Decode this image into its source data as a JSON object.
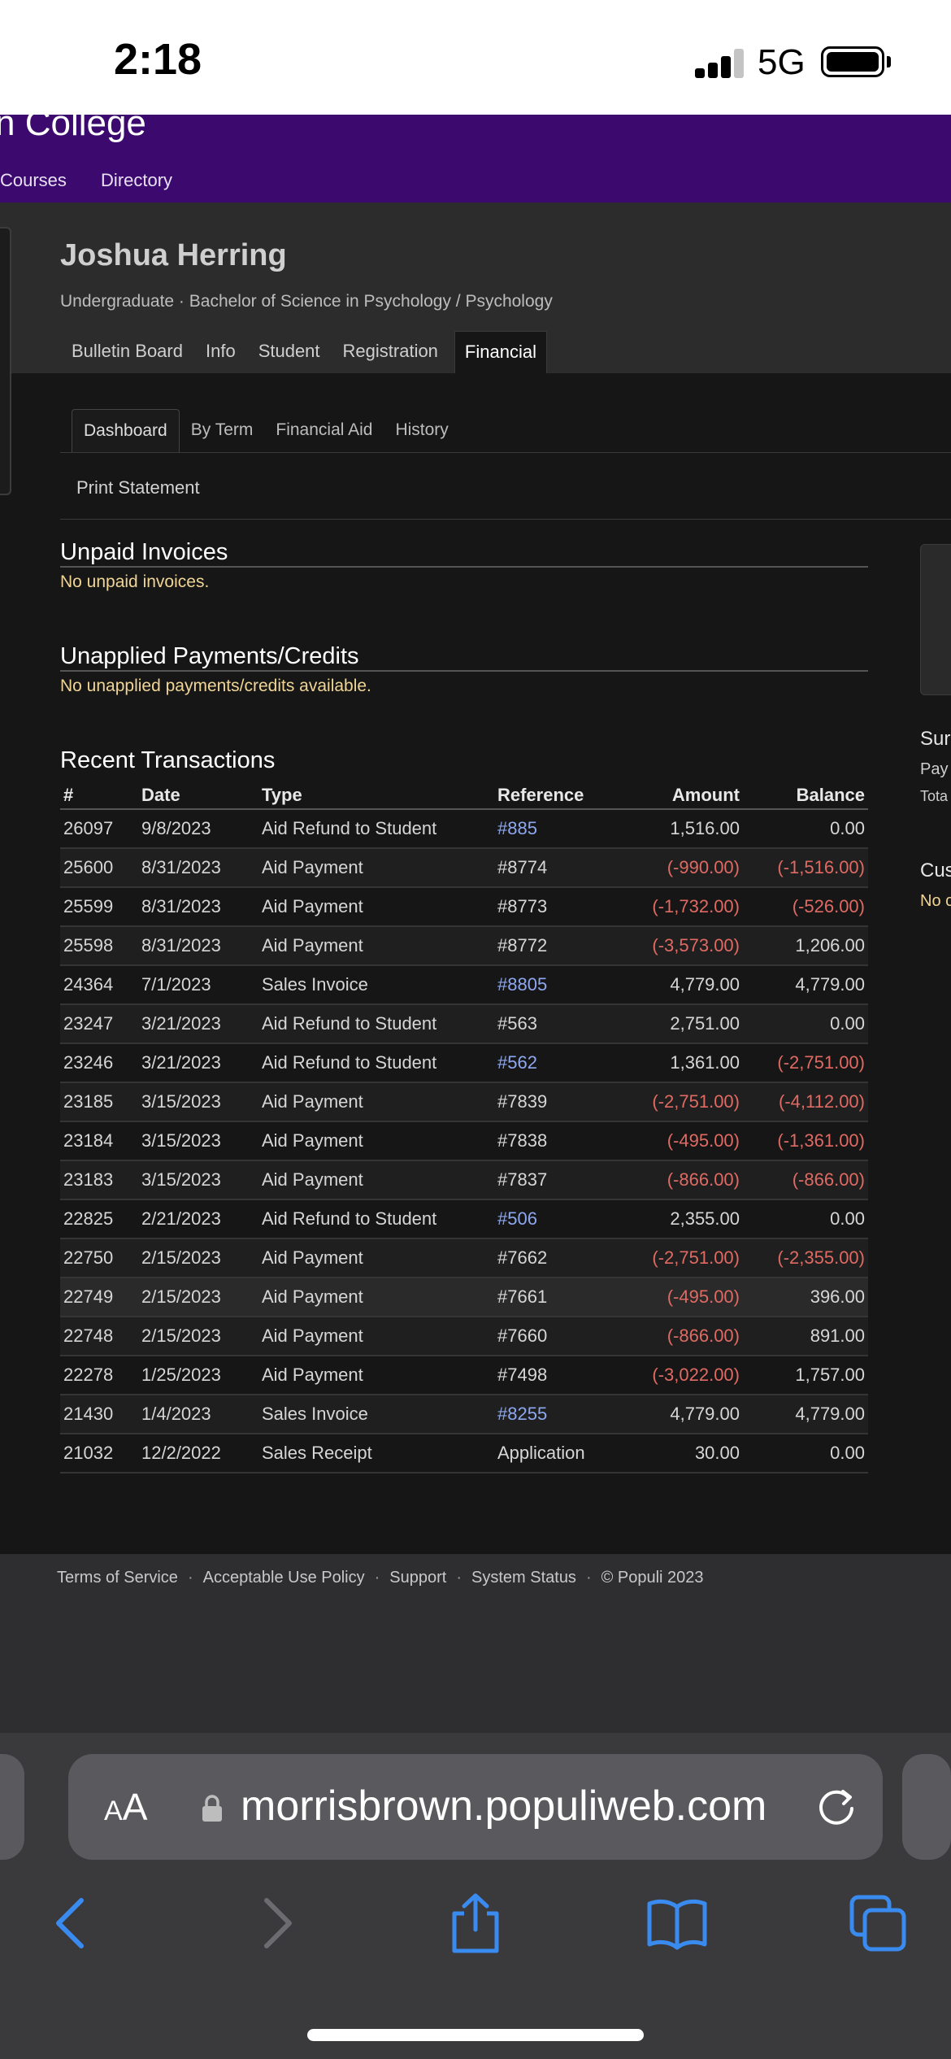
{
  "status_bar": {
    "time": "2:18",
    "network": "5G"
  },
  "header": {
    "college_name": "n College",
    "nav": [
      "Courses",
      "Directory"
    ]
  },
  "profile": {
    "name": "Joshua Herring",
    "program": "Undergraduate · Bachelor of Science in Psychology / Psychology",
    "tabs": [
      "Bulletin Board",
      "Info",
      "Student",
      "Registration",
      "Financial"
    ],
    "active_tab": "Financial"
  },
  "financial": {
    "sub_tabs": [
      "Dashboard",
      "By Term",
      "Financial Aid",
      "History"
    ],
    "active_sub_tab": "Dashboard",
    "print_statement": "Print Statement",
    "unpaid_invoices": {
      "title": "Unpaid Invoices",
      "empty": "No unpaid invoices."
    },
    "unapplied": {
      "title": "Unapplied Payments/Credits",
      "empty": "No unapplied payments/credits available."
    },
    "recent": {
      "title": "Recent Transactions",
      "columns": [
        "#",
        "Date",
        "Type",
        "Reference",
        "Amount",
        "Balance"
      ],
      "rows": [
        [
          "26097",
          "9/8/2023",
          "Aid Refund to Student",
          "#885",
          "1,516.00",
          "0.00"
        ],
        [
          "25600",
          "8/31/2023",
          "Aid Payment",
          "#8774",
          "(-990.00)",
          "(-1,516.00)"
        ],
        [
          "25599",
          "8/31/2023",
          "Aid Payment",
          "#8773",
          "(-1,732.00)",
          "(-526.00)"
        ],
        [
          "25598",
          "8/31/2023",
          "Aid Payment",
          "#8772",
          "(-3,573.00)",
          "1,206.00"
        ],
        [
          "24364",
          "7/1/2023",
          "Sales Invoice",
          "#8805",
          "4,779.00",
          "4,779.00"
        ],
        [
          "23247",
          "3/21/2023",
          "Aid Refund to Student",
          "#563",
          "2,751.00",
          "0.00"
        ],
        [
          "23246",
          "3/21/2023",
          "Aid Refund to Student",
          "#562",
          "1,361.00",
          "(-2,751.00)"
        ],
        [
          "23185",
          "3/15/2023",
          "Aid Payment",
          "#7839",
          "(-2,751.00)",
          "(-4,112.00)"
        ],
        [
          "23184",
          "3/15/2023",
          "Aid Payment",
          "#7838",
          "(-495.00)",
          "(-1,361.00)"
        ],
        [
          "23183",
          "3/15/2023",
          "Aid Payment",
          "#7837",
          "(-866.00)",
          "(-866.00)"
        ],
        [
          "22825",
          "2/21/2023",
          "Aid Refund to Student",
          "#506",
          "2,355.00",
          "0.00"
        ],
        [
          "22750",
          "2/15/2023",
          "Aid Payment",
          "#7662",
          "(-2,751.00)",
          "(-2,355.00)"
        ],
        [
          "22749",
          "2/15/2023",
          "Aid Payment",
          "#7661",
          "(-495.00)",
          "396.00"
        ],
        [
          "22748",
          "2/15/2023",
          "Aid Payment",
          "#7660",
          "(-866.00)",
          "891.00"
        ],
        [
          "22278",
          "1/25/2023",
          "Aid Payment",
          "#7498",
          "(-3,022.00)",
          "1,757.00"
        ],
        [
          "21430",
          "1/4/2023",
          "Sales Invoice",
          "#8255",
          "4,779.00",
          "4,779.00"
        ],
        [
          "21032",
          "12/2/2022",
          "Sales Receipt",
          "Application",
          "30.00",
          "0.00"
        ]
      ],
      "linked_references": [
        "#885",
        "#8805",
        "#562",
        "#506",
        "#8255"
      ]
    }
  },
  "right_column": {
    "summary_title": "Sur",
    "pay_label": "Pay",
    "total_label": "Tota",
    "cus_title": "Cus",
    "no_label": "No c"
  },
  "footer": {
    "links": [
      "Terms of Service",
      "Acceptable Use Policy",
      "Support",
      "System Status"
    ],
    "copyright": "© Populi 2023"
  },
  "browser": {
    "aa_label_small": "A",
    "aa_label_large": "A",
    "url": "morrisbrown.populiweb.com"
  },
  "colors": {
    "header_purple": "#3c0a6e",
    "negative_red": "#e06a63",
    "link_blue": "#8ea8f0",
    "notice_yellow": "#f0d596",
    "ios_blue": "#3a8bf0"
  }
}
